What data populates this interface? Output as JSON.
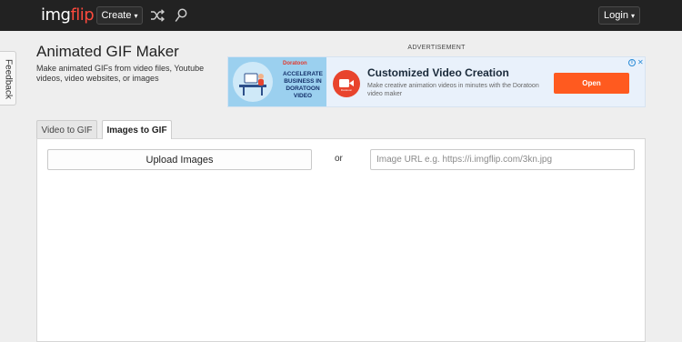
{
  "header": {
    "logo_part1": "img",
    "logo_part2": "flip",
    "create_label": "Create",
    "login_label": "Login",
    "caret": "▾"
  },
  "feedback": {
    "label": "Feedback"
  },
  "page": {
    "title": "Animated GIF Maker",
    "subtitle": "Make animated GIFs from video files, Youtube videos, video websites, or images"
  },
  "ad": {
    "label": "ADVERTISEMENT",
    "brand": "Doratoon",
    "promo_text": "ACCELERATE BUSINESS IN DORATOON VIDEO",
    "logo_text": "Doratoon",
    "headline": "Customized Video Creation",
    "description": "Make creative animation videos in minutes with the Doratoon video maker",
    "cta_label": "Open",
    "info_glyph": "i",
    "close_glyph": "✕"
  },
  "tabs": [
    {
      "label": "Video to GIF",
      "active": false
    },
    {
      "label": "Images to GIF",
      "active": true
    }
  ],
  "form": {
    "upload_label": "Upload Images",
    "or_label": "or",
    "url_placeholder": "Image URL e.g. https://i.imgflip.com/3kn.jpg",
    "url_value": ""
  },
  "colors": {
    "topbar": "#222222",
    "logo_accent": "#ff4a3d",
    "ad_cta": "#ff5a1f",
    "ad_logo": "#e8442d"
  },
  "icons": {
    "shuffle": "shuffle-icon",
    "search": "search-icon"
  }
}
